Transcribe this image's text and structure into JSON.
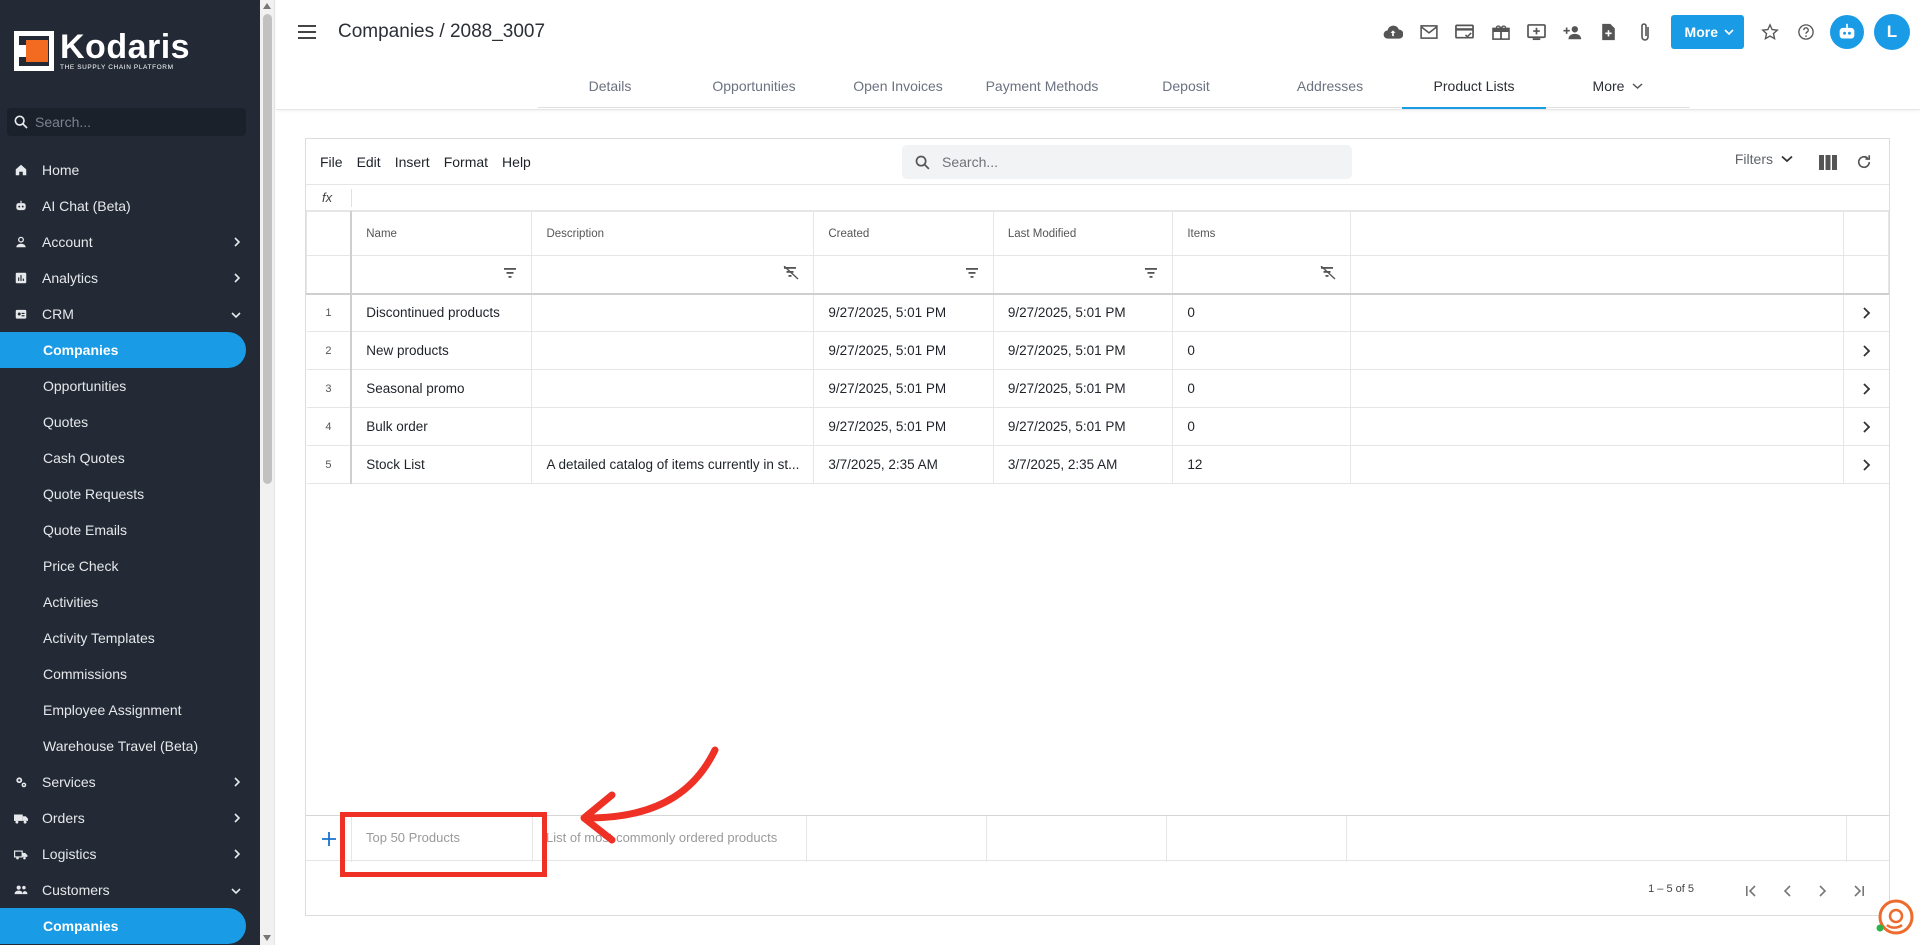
{
  "brand": {
    "name": "Kodaris",
    "tagline": "THE SUPPLY CHAIN PLATFORM"
  },
  "sidebar": {
    "search_placeholder": "Search...",
    "items": [
      {
        "label": "Home",
        "icon": "home-icon"
      },
      {
        "label": "AI Chat (Beta)",
        "icon": "robot-icon"
      },
      {
        "label": "Account",
        "icon": "person-icon",
        "chevron": "right"
      },
      {
        "label": "Analytics",
        "icon": "analytics-icon",
        "chevron": "right"
      },
      {
        "label": "CRM",
        "icon": "crm-icon",
        "chevron": "down"
      },
      {
        "label": "Companies",
        "active": true
      },
      {
        "label": "Opportunities"
      },
      {
        "label": "Quotes"
      },
      {
        "label": "Cash Quotes"
      },
      {
        "label": "Quote Requests"
      },
      {
        "label": "Quote Emails"
      },
      {
        "label": "Price Check"
      },
      {
        "label": "Activities"
      },
      {
        "label": "Activity Templates"
      },
      {
        "label": "Commissions"
      },
      {
        "label": "Employee Assignment"
      },
      {
        "label": "Warehouse Travel (Beta)"
      },
      {
        "label": "Services",
        "icon": "gears-icon",
        "chevron": "right"
      },
      {
        "label": "Orders",
        "icon": "truck-icon",
        "chevron": "right"
      },
      {
        "label": "Logistics",
        "icon": "delivery-icon",
        "chevron": "right"
      },
      {
        "label": "Customers",
        "icon": "people-icon",
        "chevron": "down"
      },
      {
        "label": "Companies",
        "active": true
      }
    ]
  },
  "header": {
    "title": "Companies / 2088_3007",
    "more_label": "More",
    "avatar_initial": "L",
    "tabs": [
      {
        "label": "Details"
      },
      {
        "label": "Opportunities"
      },
      {
        "label": "Open Invoices"
      },
      {
        "label": "Payment Methods"
      },
      {
        "label": "Deposit"
      },
      {
        "label": "Addresses"
      },
      {
        "label": "Product Lists",
        "active": true
      },
      {
        "label": "More"
      }
    ]
  },
  "grid": {
    "menu": [
      "File",
      "Edit",
      "Insert",
      "Format",
      "Help"
    ],
    "search_placeholder": "Search...",
    "filters_label": "Filters",
    "fx_label": "fx",
    "columns": [
      "Name",
      "Description",
      "Created",
      "Last Modified",
      "Items"
    ],
    "rows": [
      {
        "n": "1",
        "name": "Discontinued products",
        "description": "",
        "created": "9/27/2025, 5:01 PM",
        "modified": "9/27/2025, 5:01 PM",
        "items": "0"
      },
      {
        "n": "2",
        "name": "New products",
        "description": "",
        "created": "9/27/2025, 5:01 PM",
        "modified": "9/27/2025, 5:01 PM",
        "items": "0"
      },
      {
        "n": "3",
        "name": "Seasonal promo",
        "description": "",
        "created": "9/27/2025, 5:01 PM",
        "modified": "9/27/2025, 5:01 PM",
        "items": "0"
      },
      {
        "n": "4",
        "name": "Bulk order",
        "description": "",
        "created": "9/27/2025, 5:01 PM",
        "modified": "9/27/2025, 5:01 PM",
        "items": "0"
      },
      {
        "n": "5",
        "name": "Stock List",
        "description": "A detailed catalog of items currently in st...",
        "created": "3/7/2025, 2:35 AM",
        "modified": "3/7/2025, 2:35 AM",
        "items": "12"
      }
    ],
    "new_row": {
      "name_placeholder": "Top 50 Products",
      "description_placeholder": "List of most commonly ordered products"
    },
    "pager_text": "1 – 5 of 5"
  },
  "colors": {
    "accent": "#1a9be6",
    "sidebar_bg": "#232a35",
    "annotation": "#ee3124"
  }
}
